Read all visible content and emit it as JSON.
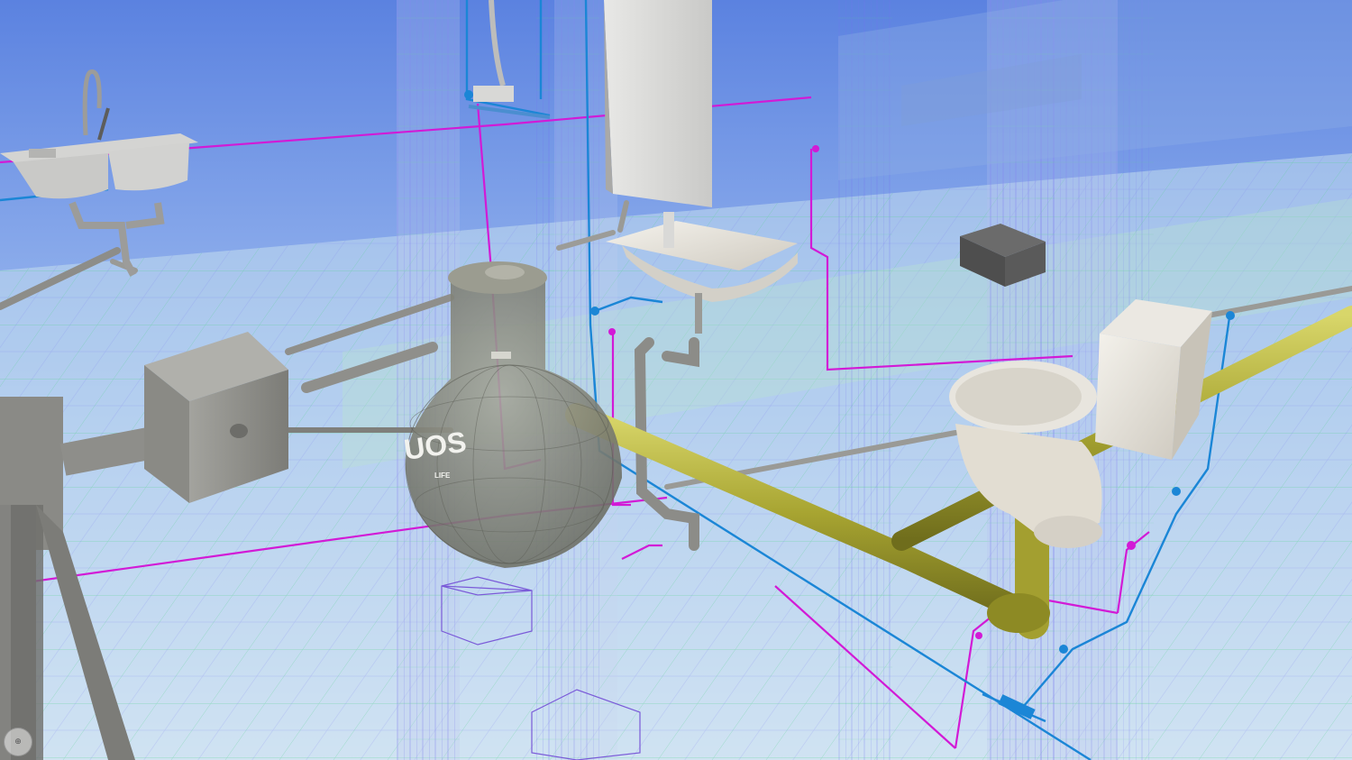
{
  "scene": {
    "background_top": "#6f93e6",
    "background_bottom": "#cfe0f4",
    "colors": {
      "hot_water_pipe": "#d21ad6",
      "cold_water_pipe": "#1b86d6",
      "sewer_pipe": "#b8b63a",
      "drain_pipe": "#9a9a98",
      "fixture": "#e6e2da",
      "grid_green": "#54d28a",
      "grid_blue": "#6c6cf0",
      "tank": "#8e8f83"
    }
  },
  "tank": {
    "brand": "UOS",
    "sub_label": "LIFE"
  },
  "viewcube": {
    "icon": "compass-icon",
    "label": "⊕"
  }
}
